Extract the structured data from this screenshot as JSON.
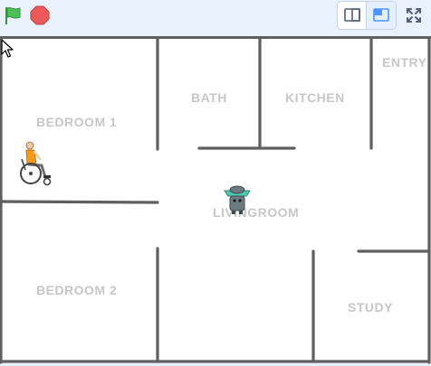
{
  "toolbar": {
    "green_flag_icon": "green-flag-icon",
    "stop_icon": "stop-sign-icon",
    "layout_small_icon": "small-stage-icon",
    "layout_large_icon": "large-stage-icon",
    "fullscreen_icon": "fullscreen-icon"
  },
  "colors": {
    "flag": "#4cbf56",
    "stop": "#ec5959",
    "accent": "#4c97ff",
    "walls": "#5f5f5f",
    "labels": "#c7c7c7"
  },
  "stage": {
    "rooms": [
      {
        "id": "bedroom1",
        "label": "BEDROOM 1"
      },
      {
        "id": "bath",
        "label": "BATH"
      },
      {
        "id": "kitchen",
        "label": "KITCHEN"
      },
      {
        "id": "entry",
        "label": "ENTRY"
      },
      {
        "id": "livingroom",
        "label": "LIVINGROOM"
      },
      {
        "id": "bedroom2",
        "label": "BEDROOM 2"
      },
      {
        "id": "study",
        "label": "STUDY"
      }
    ],
    "sprites": [
      {
        "id": "wheelchair-person",
        "icon": "wheelchair-person-icon"
      },
      {
        "id": "robot",
        "icon": "robot-icon"
      }
    ]
  }
}
